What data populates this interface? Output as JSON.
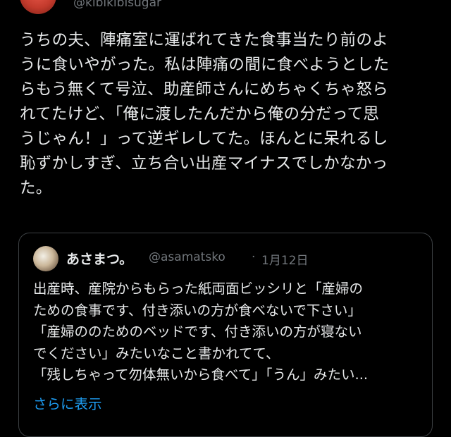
{
  "author": {
    "handle": "@kibikibisugar"
  },
  "tweet": {
    "lines": [
      "うちの夫、陣痛室に運ばれてきた食事当たり前のよ",
      "うに食いやがった。私は陣痛の間に食べようとした",
      "らもう無くて号泣、助産師さんにめちゃくちゃ怒ら",
      "れてたけど、「俺に渡したんだから俺の分だって思",
      "うじゃん！」って逆ギレしてた。ほんとに呆れるし",
      "恥ずかしすぎ、立ち合い出産マイナスでしかなかっ",
      "た。"
    ]
  },
  "quote": {
    "name": "あさまつ。",
    "handle": "@asamatsko",
    "separator": "·",
    "date": "1月12日",
    "lines": [
      "出産時、産院からもらった紙両面ビッシリと「産婦の",
      "ための食事です、付き添いの方が食べないで下さい」",
      "「産婦ののためのベッドです、付き添いの方が寝ない",
      "でください」みたいなこと書かれてて、",
      "「残しちゃって勿体無いから食べて」「うん」みたい..."
    ],
    "show_more": "さらに表示"
  },
  "colors": {
    "link": "#1d9bf0",
    "muted": "#71767b",
    "text": "#e7e9ea",
    "background": "#000000"
  }
}
